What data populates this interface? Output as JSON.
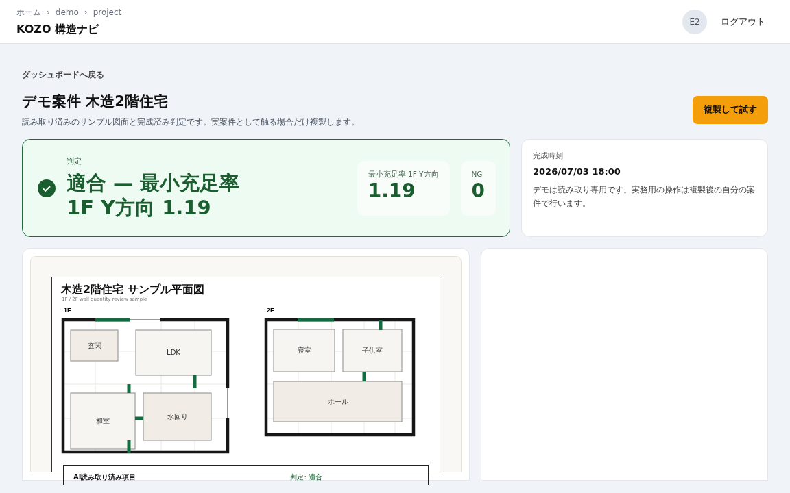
{
  "header": {
    "breadcrumbs": [
      "ホーム",
      "demo",
      "project"
    ],
    "separator": "›",
    "app_title": "KOZO 構造ナビ",
    "avatar": "E2",
    "logout": "ログアウト"
  },
  "back_link": "ダッシュボードへ戻る",
  "page_title": "デモ案件 木造2階住宅",
  "description": "読み取り済みのサンプル図面と完成済み判定です。実案件として触る場合だけ複製します。",
  "duplicate_button": "複製して試す",
  "verdict": {
    "label": "判定",
    "passed": true,
    "headline": "適合 — 最小充足率 1F Y方向 1.19",
    "metrics": [
      {
        "label": "最小充足率 1F Y方向",
        "value": "1.19"
      },
      {
        "label": "NG",
        "value": "0"
      }
    ]
  },
  "completion": {
    "label": "完成時刻",
    "time": "2026/07/03 18:00",
    "note": "デモは読み取り専用です。実務用の操作は複製後の自分の案件で行います。"
  },
  "plan": {
    "title": "木造2階住宅 サンプル平面図",
    "subtitle": "1F / 2F wall quantity review sample",
    "floors": [
      {
        "label": "1F",
        "rooms": [
          {
            "name": "玄関"
          },
          {
            "name": "LDK"
          },
          {
            "name": "和室"
          },
          {
            "name": "水回り"
          }
        ]
      },
      {
        "label": "2F",
        "rooms": [
          {
            "name": "寝室"
          },
          {
            "name": "子供室"
          },
          {
            "name": "ホール"
          }
        ]
      }
    ],
    "summary": {
      "title": "AI読み取り済み項目",
      "verdict": "判定: 適合"
    }
  }
}
